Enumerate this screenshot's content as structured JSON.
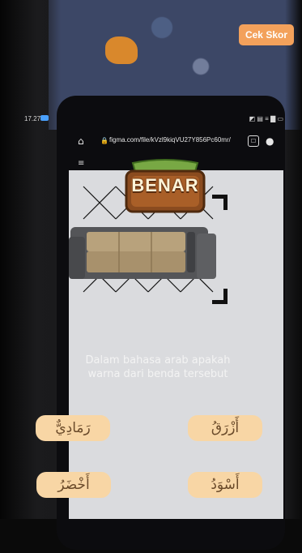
{
  "top_button": {
    "label": "Cek Skor"
  },
  "phone_status": {
    "time": "17.27",
    "icons": "◩ ▤ ≡ ▇ ▭"
  },
  "browser": {
    "url": "figma.com/file/kVzl9kiqVU27Y856Pc60mr/"
  },
  "feedback": {
    "text": "BENAR"
  },
  "question": {
    "line1": "Dalam bahasa arab apakah",
    "line2": "warna dari benda tersebut"
  },
  "answers": [
    {
      "text": "رَمَادِيٌّ"
    },
    {
      "text": "أَزْرَقُ"
    },
    {
      "text": "أَخْضَرُ"
    },
    {
      "text": "أَسْوَدُ"
    }
  ],
  "colors": {
    "accent": "#f3a15b",
    "answer_bg": "#f8d6a5",
    "screen_bg": "#dadbde"
  }
}
